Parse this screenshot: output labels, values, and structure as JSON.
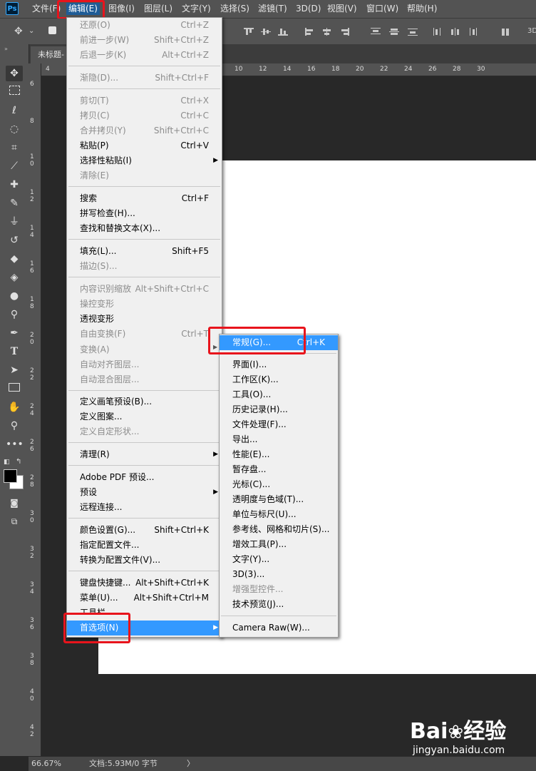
{
  "app": {
    "logo": "Ps"
  },
  "menubar": {
    "items": [
      "文件(F)",
      "编辑(E)",
      "图像(I)",
      "图层(L)",
      "文字(Y)",
      "选择(S)",
      "滤镜(T)",
      "3D(D)",
      "视图(V)",
      "窗口(W)",
      "帮助(H)"
    ],
    "active_index": 1
  },
  "document": {
    "tab_title": "未标题-"
  },
  "rulers": {
    "top": [
      "4",
      "10",
      "12",
      "14",
      "16",
      "18",
      "20",
      "22",
      "24",
      "26",
      "28",
      "30"
    ],
    "left": [
      "6",
      "8",
      "1 0",
      "1 2",
      "1 4",
      "1 6",
      "1 8",
      "2 0",
      "2 2",
      "2 4",
      "2 6",
      "2 8",
      "3 0",
      "3 2",
      "3 4",
      "3 6",
      "3 8",
      "4 0",
      "4 2"
    ]
  },
  "edit_menu": {
    "items": [
      {
        "label": "还原(O)",
        "shortcut": "Ctrl+Z",
        "disabled": true
      },
      {
        "label": "前进一步(W)",
        "shortcut": "Shift+Ctrl+Z",
        "disabled": true
      },
      {
        "label": "后退一步(K)",
        "shortcut": "Alt+Ctrl+Z",
        "disabled": true
      },
      {
        "label": "渐隐(D)...",
        "shortcut": "Shift+Ctrl+F",
        "disabled": true
      },
      {
        "label": "剪切(T)",
        "shortcut": "Ctrl+X",
        "disabled": true
      },
      {
        "label": "拷贝(C)",
        "shortcut": "Ctrl+C",
        "disabled": true
      },
      {
        "label": "合并拷贝(Y)",
        "shortcut": "Shift+Ctrl+C",
        "disabled": true
      },
      {
        "label": "粘贴(P)",
        "shortcut": "Ctrl+V",
        "disabled": false
      },
      {
        "label": "选择性粘贴(I)",
        "shortcut": "",
        "disabled": false,
        "submenu": true
      },
      {
        "label": "清除(E)",
        "shortcut": "",
        "disabled": true
      },
      {
        "label": "搜索",
        "shortcut": "Ctrl+F",
        "disabled": false
      },
      {
        "label": "拼写检查(H)...",
        "shortcut": "",
        "disabled": false
      },
      {
        "label": "查找和替换文本(X)...",
        "shortcut": "",
        "disabled": false
      },
      {
        "label": "填充(L)...",
        "shortcut": "Shift+F5",
        "disabled": false
      },
      {
        "label": "描边(S)...",
        "shortcut": "",
        "disabled": true
      },
      {
        "label": "内容识别缩放",
        "shortcut": "Alt+Shift+Ctrl+C",
        "disabled": true
      },
      {
        "label": "操控变形",
        "shortcut": "",
        "disabled": true
      },
      {
        "label": "透视变形",
        "shortcut": "",
        "disabled": false
      },
      {
        "label": "自由变换(F)",
        "shortcut": "Ctrl+T",
        "disabled": true
      },
      {
        "label": "变换(A)",
        "shortcut": "",
        "disabled": true
      },
      {
        "label": "自动对齐图层...",
        "shortcut": "",
        "disabled": true
      },
      {
        "label": "自动混合图层...",
        "shortcut": "",
        "disabled": true
      },
      {
        "label": "定义画笔预设(B)...",
        "shortcut": "",
        "disabled": false
      },
      {
        "label": "定义图案...",
        "shortcut": "",
        "disabled": false
      },
      {
        "label": "定义自定形状...",
        "shortcut": "",
        "disabled": true
      },
      {
        "label": "清理(R)",
        "shortcut": "",
        "disabled": false,
        "submenu": true
      },
      {
        "label": "Adobe PDF 预设...",
        "shortcut": "",
        "disabled": false
      },
      {
        "label": "预设",
        "shortcut": "",
        "disabled": false,
        "submenu": true
      },
      {
        "label": "远程连接...",
        "shortcut": "",
        "disabled": false
      },
      {
        "label": "颜色设置(G)...",
        "shortcut": "Shift+Ctrl+K",
        "disabled": false
      },
      {
        "label": "指定配置文件...",
        "shortcut": "",
        "disabled": false
      },
      {
        "label": "转换为配置文件(V)...",
        "shortcut": "",
        "disabled": false
      },
      {
        "label": "键盘快捷键...",
        "shortcut": "Alt+Shift+Ctrl+K",
        "disabled": false
      },
      {
        "label": "菜单(U)...",
        "shortcut": "Alt+Shift+Ctrl+M",
        "disabled": false
      },
      {
        "label": "工具栏...",
        "shortcut": "",
        "disabled": false
      },
      {
        "label": "首选项(N)",
        "shortcut": "",
        "disabled": false,
        "submenu": true,
        "highlighted": true
      }
    ]
  },
  "prefs_menu": {
    "items": [
      {
        "label": "常规(G)...",
        "shortcut": "Ctrl+K",
        "disabled": false,
        "highlighted": true
      },
      {
        "label": "界面(I)...",
        "shortcut": "",
        "disabled": false
      },
      {
        "label": "工作区(K)...",
        "shortcut": "",
        "disabled": false
      },
      {
        "label": "工具(O)...",
        "shortcut": "",
        "disabled": false
      },
      {
        "label": "历史记录(H)...",
        "shortcut": "",
        "disabled": false
      },
      {
        "label": "文件处理(F)...",
        "shortcut": "",
        "disabled": false
      },
      {
        "label": "导出...",
        "shortcut": "",
        "disabled": false
      },
      {
        "label": "性能(E)...",
        "shortcut": "",
        "disabled": false
      },
      {
        "label": "暂存盘...",
        "shortcut": "",
        "disabled": false
      },
      {
        "label": "光标(C)...",
        "shortcut": "",
        "disabled": false
      },
      {
        "label": "透明度与色域(T)...",
        "shortcut": "",
        "disabled": false
      },
      {
        "label": "单位与标尺(U)...",
        "shortcut": "",
        "disabled": false
      },
      {
        "label": "参考线、网格和切片(S)...",
        "shortcut": "",
        "disabled": false
      },
      {
        "label": "增效工具(P)...",
        "shortcut": "",
        "disabled": false
      },
      {
        "label": "文字(Y)...",
        "shortcut": "",
        "disabled": false
      },
      {
        "label": "3D(3)...",
        "shortcut": "",
        "disabled": false
      },
      {
        "label": "增强型控件...",
        "shortcut": "",
        "disabled": true
      },
      {
        "label": "技术预览(J)...",
        "shortcut": "",
        "disabled": false
      },
      {
        "label": "Camera Raw(W)...",
        "shortcut": "",
        "disabled": false
      }
    ]
  },
  "status": {
    "zoom": "66.67%",
    "doc_info": "文档:5.93M/0 字节",
    "arrow": "〉"
  },
  "watermark": {
    "brand": "Bai",
    "brand2": "经验",
    "url": "jingyan.baidu.com"
  },
  "colors": {
    "highlight_blue": "#3399ff",
    "annotation_red": "#e8141c",
    "menu_bg": "#f0f0f0",
    "ui_gray": "#535353"
  }
}
